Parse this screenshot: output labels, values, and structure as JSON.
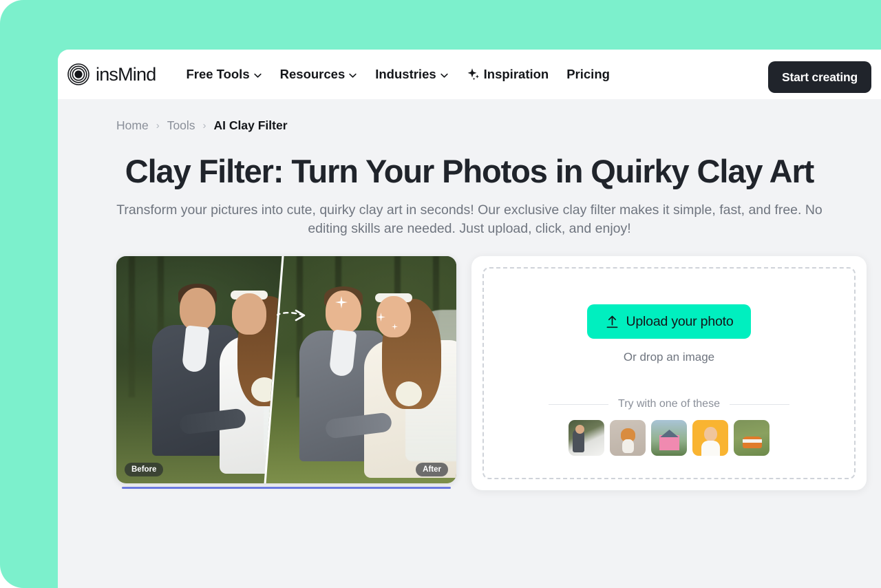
{
  "window": {
    "backdrop_color": "#7cf0cc",
    "page_background": "#f2f3f5"
  },
  "nav": {
    "brand_name": "insMind",
    "brand_icon": "concentric-rings-logo-icon",
    "links": [
      {
        "label": "Free Tools",
        "has_dropdown": true,
        "icon": null
      },
      {
        "label": "Resources",
        "has_dropdown": true,
        "icon": null
      },
      {
        "label": "Industries",
        "has_dropdown": true,
        "icon": null
      },
      {
        "label": "Inspiration",
        "has_dropdown": false,
        "icon": "sparkle-icon"
      },
      {
        "label": "Pricing",
        "has_dropdown": false,
        "icon": null
      }
    ],
    "cta_label": "Start creating",
    "cta_color": "#20242b"
  },
  "breadcrumb": {
    "items": [
      {
        "label": "Home",
        "current": false
      },
      {
        "label": "Tools",
        "current": false
      },
      {
        "label": "AI Clay Filter",
        "current": true
      }
    ],
    "separator": "›"
  },
  "hero": {
    "title": "Clay Filter: Turn Your Photos in Quirky Clay Art",
    "subtitle": "Transform your pictures into cute, quirky clay art in seconds! Our exclusive clay filter makes it simple, fast, and free. No editing skills are needed. Just upload, click, and enjoy!"
  },
  "before_after": {
    "before_label": "Before",
    "after_label": "After",
    "subject": "wedding couple photo transformed into clay art",
    "slider_color": "#6b7ae0"
  },
  "upload": {
    "button_label": "Upload your photo",
    "button_icon": "upload-arrow-icon",
    "button_color": "#00efbf",
    "drop_hint": "Or drop an image",
    "samples_label": "Try with one of these",
    "samples": [
      {
        "name": "wedding-couple"
      },
      {
        "name": "corgi-dog"
      },
      {
        "name": "pink-house"
      },
      {
        "name": "girl-yellow-background"
      },
      {
        "name": "orange-van-road"
      }
    ]
  }
}
